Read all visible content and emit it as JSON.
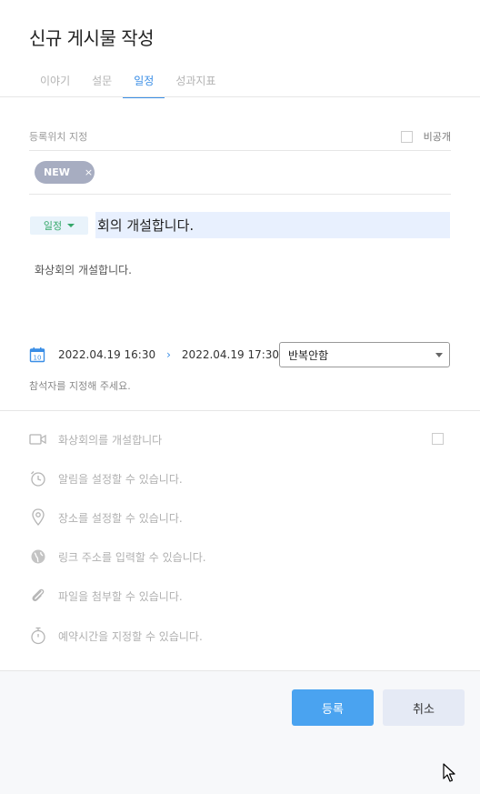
{
  "dialog": {
    "title": "신규 게시물 작성"
  },
  "tabs": [
    {
      "label": "이야기"
    },
    {
      "label": "설문"
    },
    {
      "label": "일정"
    },
    {
      "label": "성과지표"
    }
  ],
  "location": {
    "label": "등록위치 지정",
    "private_label": "비공개",
    "tag": "NEW",
    "tag_remove": "×"
  },
  "post": {
    "category": "일정",
    "title_value": "회의 개설합니다.",
    "body": "화상회의 개설합니다."
  },
  "schedule": {
    "calendar_day": "10",
    "start": "2022.04.19 16:30",
    "arrow": "›",
    "end": "2022.04.19 17:30",
    "repeat": "반복안함",
    "attendee_hint": "참석자를 지정해 주세요."
  },
  "options": [
    {
      "label": "화상회의를 개설합니다",
      "icon": "video-icon"
    },
    {
      "label": "알림을 설정할 수 있습니다.",
      "icon": "alarm-icon"
    },
    {
      "label": "장소를 설정할 수 있습니다.",
      "icon": "location-pin-icon"
    },
    {
      "label": "링크 주소를 입력할 수 있습니다.",
      "icon": "globe-icon"
    },
    {
      "label": "파일을 첨부할 수 있습니다.",
      "icon": "paperclip-icon"
    },
    {
      "label": "예약시간을 지정할 수 있습니다.",
      "icon": "stopwatch-icon"
    }
  ],
  "footer": {
    "submit": "등록",
    "cancel": "취소"
  },
  "colors": {
    "accent": "#3a8ee6",
    "primary_button": "#4aa3f0",
    "tag_bg": "#a7adc1",
    "category_text": "#35a86a"
  }
}
